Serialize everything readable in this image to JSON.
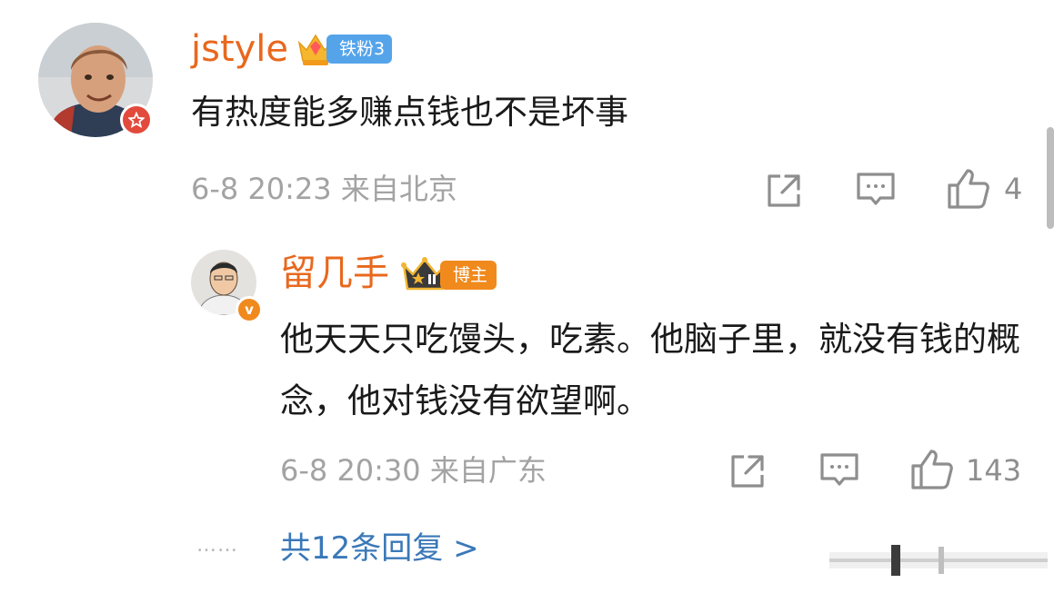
{
  "comment": {
    "username": "jstyle",
    "fan_badge": "铁粉3",
    "text": "有热度能多赚点钱也不是坏事",
    "meta": "6-8 20:23 来自北京",
    "likes": "4"
  },
  "reply": {
    "username": "留几手",
    "host_badge": "博主",
    "text": "他天天只吃馒头，吃素。他脑子里，就没有钱的概念，他对钱没有欲望啊。",
    "meta": "6-8 20:30 来自广东",
    "likes": "143"
  },
  "more_replies": {
    "dots": "……",
    "label": "共12条回复 >"
  },
  "colors": {
    "username": "#e8681e",
    "link": "#3a78b8",
    "meta": "#a3a3a3",
    "fan_badge": "#55a4ea",
    "host_badge": "#f08a1d"
  }
}
